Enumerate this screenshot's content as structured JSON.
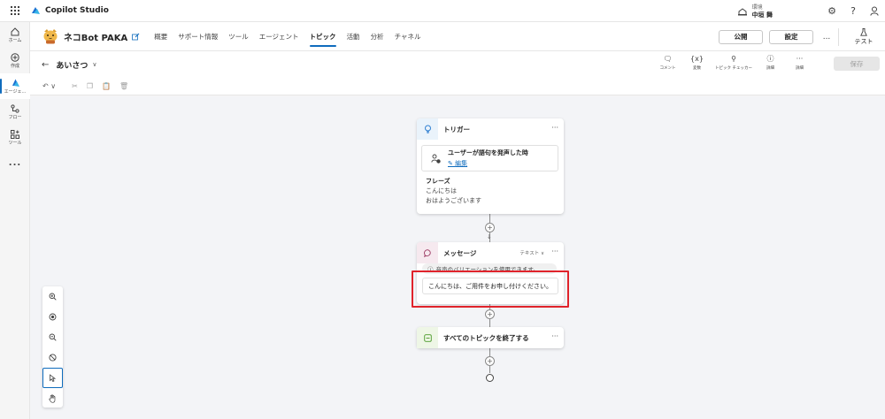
{
  "app": {
    "name": "Copilot Studio",
    "environment_label": "環境",
    "environment_name": "中垣 舞"
  },
  "rail": {
    "items": [
      {
        "label": "ホーム",
        "icon": "home-icon"
      },
      {
        "label": "作成",
        "icon": "create-icon"
      },
      {
        "label": "エージェ...",
        "icon": "agent-icon",
        "active": true
      },
      {
        "label": "フロー",
        "icon": "flow-icon"
      },
      {
        "label": "ツール",
        "icon": "tools-icon"
      }
    ],
    "more": "..."
  },
  "agent": {
    "name": "ネコBot PAKA",
    "tabs": [
      {
        "label": "概要"
      },
      {
        "label": "サポート情報"
      },
      {
        "label": "ツール"
      },
      {
        "label": "エージェント"
      },
      {
        "label": "トピック",
        "active": true
      },
      {
        "label": "活動"
      },
      {
        "label": "分析"
      },
      {
        "label": "チャネル"
      }
    ],
    "publish_label": "公開",
    "settings_label": "設定",
    "more": "...",
    "test_label": "テスト"
  },
  "topic": {
    "name": "あいさつ",
    "tools": [
      {
        "label": "コメント",
        "icon": "comment-icon"
      },
      {
        "label": "変数",
        "icon": "variable-icon"
      },
      {
        "label": "トピック チェッカー",
        "icon": "topic-checker-icon"
      },
      {
        "label": "詳細",
        "icon": "info-icon"
      },
      {
        "label": "詳細",
        "icon": "more-icon"
      }
    ],
    "save_label": "保存"
  },
  "canvas": {
    "trigger": {
      "title": "トリガー",
      "card_text": "ユーザーが語句を発声した時",
      "edit_label": "編集",
      "phrases_title": "フレーズ",
      "phrases": [
        "こんにちは",
        "おはようございます"
      ]
    },
    "message": {
      "title": "メッセージ",
      "type_label": "テキスト",
      "voice_note": "音声のバリエーションを使用できます。",
      "text": "こんにちは、ご用件をお申し付けください。"
    },
    "end": {
      "title": "すべてのトピックを終了する"
    }
  },
  "colors": {
    "accent": "#0f6cbd",
    "highlight": "#e0232b"
  }
}
